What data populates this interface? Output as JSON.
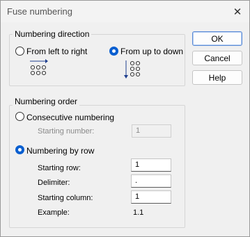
{
  "window": {
    "title": "Fuse numbering",
    "close_icon": "close-icon"
  },
  "buttons": {
    "ok": "OK",
    "cancel": "Cancel",
    "help": "Help"
  },
  "numbering_direction": {
    "group_label": "Numbering direction",
    "options": [
      {
        "label": "From left to right",
        "checked": false,
        "icon": "left-to-right-icon"
      },
      {
        "label": "From up to down",
        "checked": true,
        "icon": "up-to-down-icon"
      }
    ]
  },
  "numbering_order": {
    "group_label": "Numbering order",
    "consecutive": {
      "label": "Consecutive numbering",
      "checked": false,
      "starting_number_label": "Starting number:",
      "starting_number_value": "1"
    },
    "by_row": {
      "label": "Numbering by row",
      "checked": true,
      "starting_row_label": "Starting row:",
      "starting_row_value": "1",
      "delimiter_label": "Delimiter:",
      "delimiter_value": ".",
      "starting_column_label": "Starting column:",
      "starting_column_value": "1",
      "example_label": "Example:",
      "example_value": "1.1"
    }
  },
  "colors": {
    "accent": "#0a5fd0",
    "arrow": "#1f3f8f",
    "disabled_text": "#8a8a8a"
  }
}
